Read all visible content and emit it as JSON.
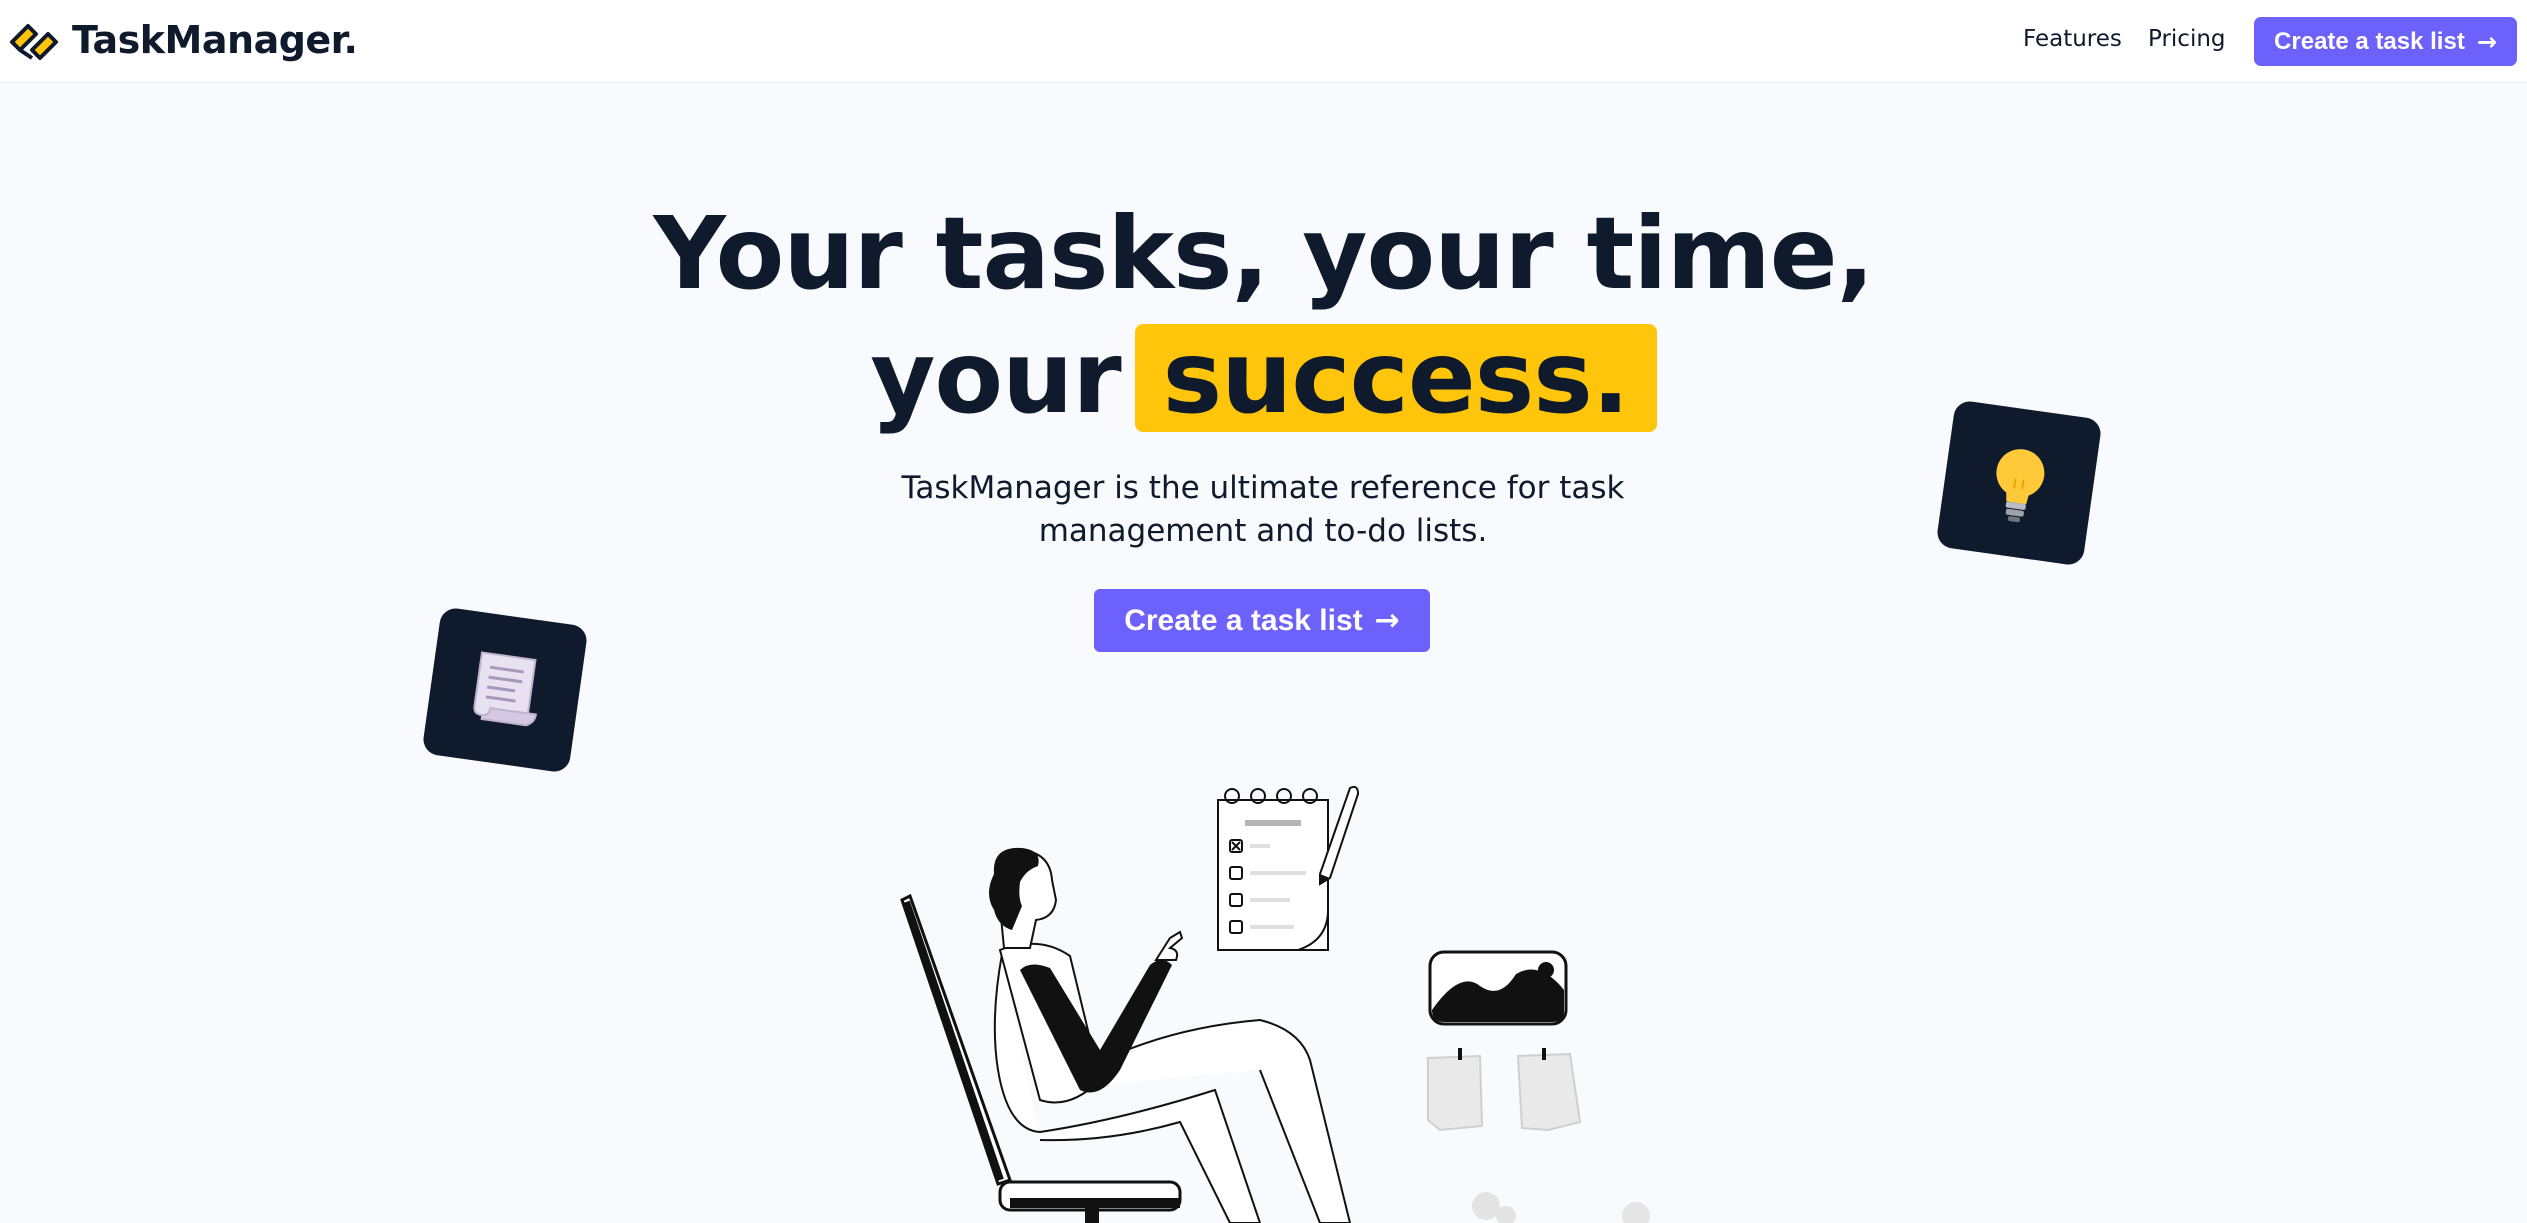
{
  "navbar": {
    "brand": "TaskManager.",
    "links": [
      {
        "label": "Features"
      },
      {
        "label": "Pricing"
      }
    ],
    "cta_label": "Create a task list",
    "cta_icon": "arrow-right-icon"
  },
  "hero": {
    "line1": "Your tasks, your time,",
    "line2_prefix": "your",
    "line2_highlight": "success.",
    "subtitle": "TaskManager is the ultimate reference for task management and to-do lists.",
    "cta_label": "Create a task list",
    "cta_icon": "arrow-right-icon"
  },
  "decor": {
    "tiles": [
      {
        "icon": "lightbulb-icon"
      },
      {
        "icon": "scroll-icon"
      }
    ],
    "illustration": "person-in-chair-illustration"
  },
  "colors": {
    "accent": "#6c62fb",
    "highlight": "#ffc50a",
    "dark": "#0f1a2c",
    "background": "#f9fafd"
  }
}
